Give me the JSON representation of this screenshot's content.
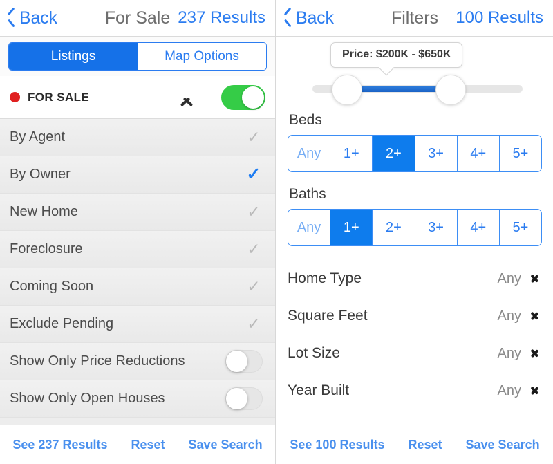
{
  "colors": {
    "accent_blue": "#2b7cf0",
    "selected_blue": "#0e7ced",
    "toggle_green": "#35cc47",
    "status_red": "#e02020",
    "link_blue": "#4a90ee",
    "muted_gray": "#8a8a8a"
  },
  "left_panel": {
    "nav": {
      "back_label": "Back",
      "title": "For Sale",
      "results_label": "237 Results"
    },
    "tabs": [
      {
        "label": "Listings",
        "active": true
      },
      {
        "label": "Map Options",
        "active": false
      }
    ],
    "section_header": {
      "label": "FOR SALE",
      "status_dot": "red-dot-icon",
      "collapse_icon": "chevron-up-icon",
      "toggle_state": "on"
    },
    "options": [
      {
        "label": "By Agent",
        "control": "check",
        "checked": false
      },
      {
        "label": "By Owner",
        "control": "check",
        "checked": true
      },
      {
        "label": "New Home",
        "control": "check",
        "checked": false
      },
      {
        "label": "Foreclosure",
        "control": "check",
        "checked": false
      },
      {
        "label": "Coming Soon",
        "control": "check",
        "checked": false
      },
      {
        "label": "Exclude Pending",
        "control": "check",
        "checked": false
      },
      {
        "label": "Show Only Price Reductions",
        "control": "toggle",
        "checked": false
      },
      {
        "label": "Show Only Open Houses",
        "control": "toggle",
        "checked": false
      }
    ],
    "bottom_bar": {
      "see_results": "See 237 Results",
      "reset": "Reset",
      "save_search": "Save Search"
    }
  },
  "right_panel": {
    "nav": {
      "back_label": "Back",
      "title": "Filters",
      "results_label": "100 Results"
    },
    "price": {
      "tooltip": "Price: $200K - $650K",
      "min_label": "$200K",
      "max_label": "$650K"
    },
    "beds": {
      "label": "Beds",
      "options": [
        "Any",
        "1+",
        "2+",
        "3+",
        "4+",
        "5+"
      ],
      "selected": "2+"
    },
    "baths": {
      "label": "Baths",
      "options": [
        "Any",
        "1+",
        "2+",
        "3+",
        "4+",
        "5+"
      ],
      "selected": "1+"
    },
    "detail_rows": [
      {
        "label": "Home Type",
        "value": "Any"
      },
      {
        "label": "Square Feet",
        "value": "Any"
      },
      {
        "label": "Lot Size",
        "value": "Any"
      },
      {
        "label": "Year Built",
        "value": "Any"
      }
    ],
    "bottom_bar": {
      "see_results": "See 100 Results",
      "reset": "Reset",
      "save_search": "Save Search"
    }
  },
  "glyphs": {
    "check": "✓"
  }
}
